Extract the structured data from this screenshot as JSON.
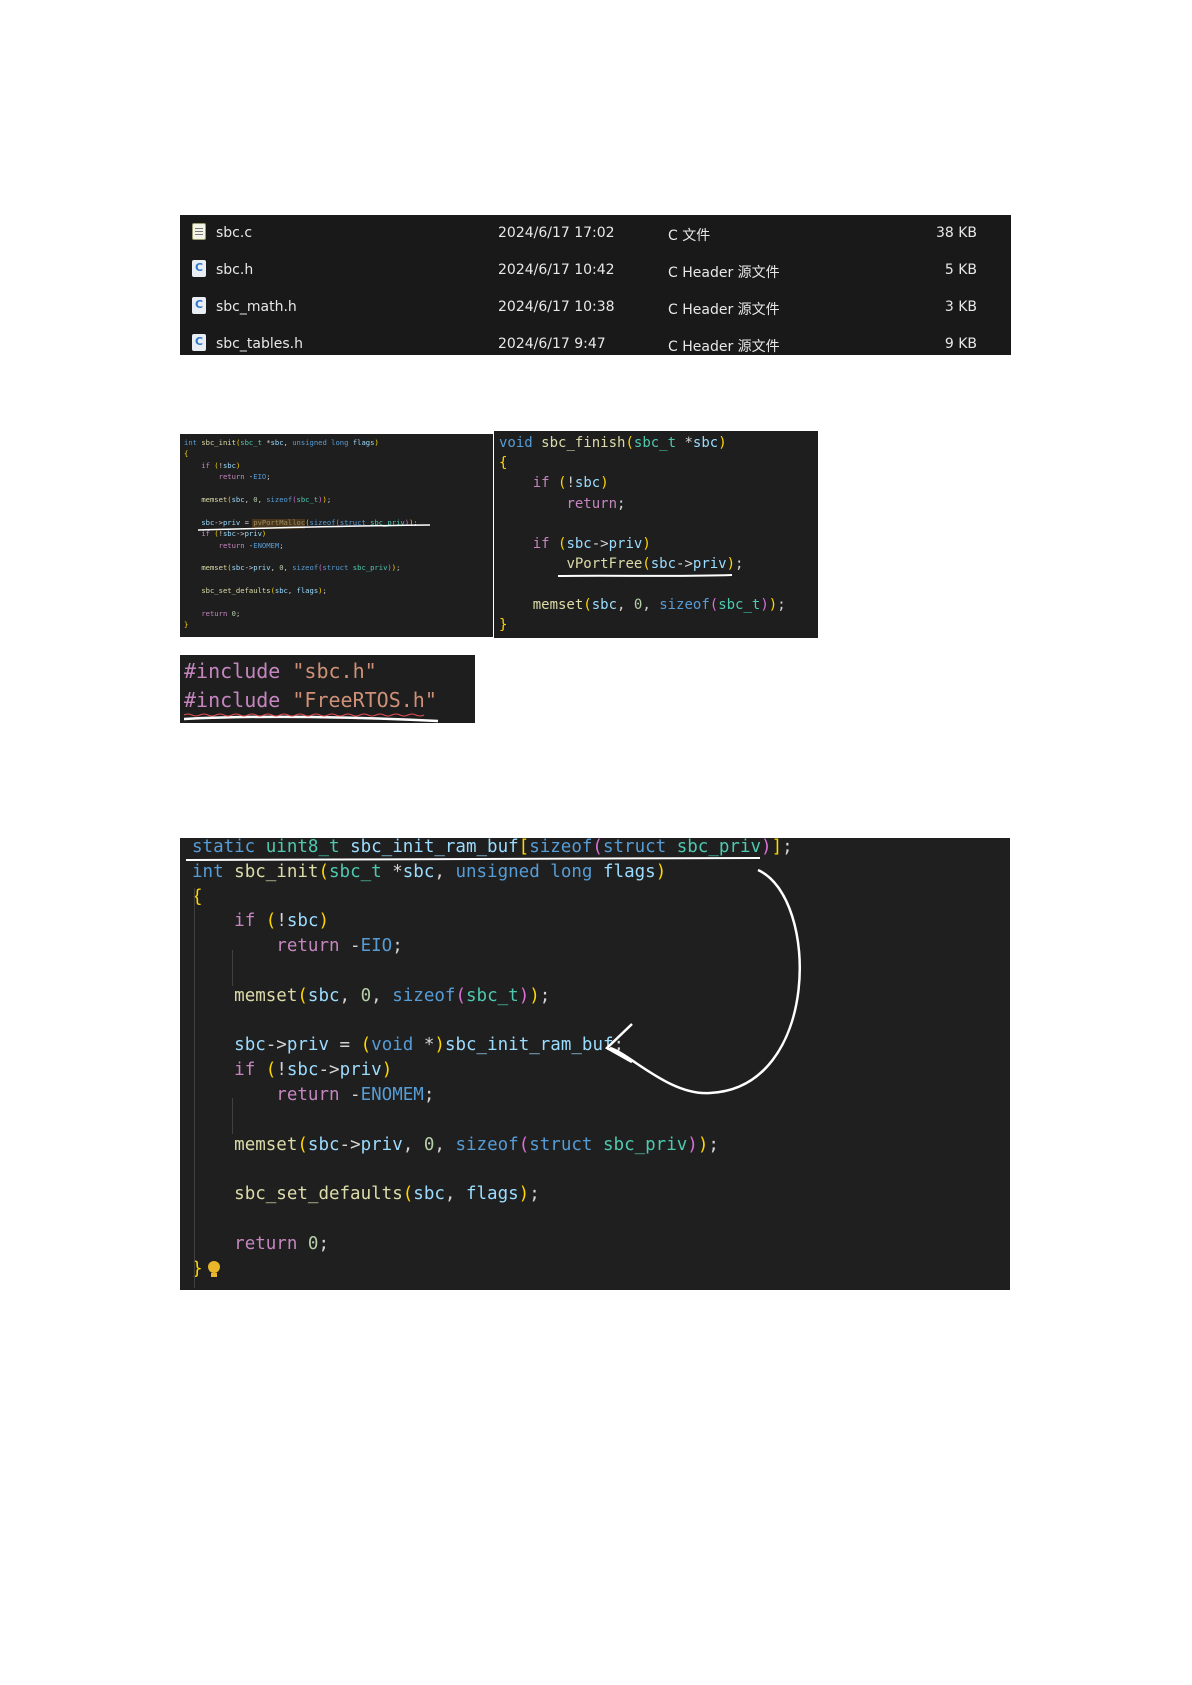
{
  "files": {
    "rows": [
      {
        "name": "sbc.c",
        "date": "2024/6/17 17:02",
        "type": "C 文件",
        "size": "38 KB",
        "icon": "c-source-file-icon"
      },
      {
        "name": "sbc.h",
        "date": "2024/6/17 10:42",
        "type": "C Header 源文件",
        "size": "5 KB",
        "icon": "c-header-file-icon"
      },
      {
        "name": "sbc_math.h",
        "date": "2024/6/17 10:38",
        "type": "C Header 源文件",
        "size": "3 KB",
        "icon": "c-header-file-icon"
      },
      {
        "name": "sbc_tables.h",
        "date": "2024/6/17 9:47",
        "type": "C Header 源文件",
        "size": "9 KB",
        "icon": "c-header-file-icon"
      }
    ]
  },
  "code_small_init": {
    "lines": [
      "int sbc_init(sbc_t *sbc, unsigned long flags)",
      "{",
      "    if (!sbc)",
      "        return -EIO;",
      "",
      "    memset(sbc, 0, sizeof(sbc_t));",
      "",
      "    sbc->priv = pvPortMalloc(sizeof(struct sbc_priv));",
      "    if (!sbc->priv)",
      "        return -ENOMEM;",
      "",
      "    memset(sbc->priv, 0, sizeof(struct sbc_priv));",
      "",
      "    sbc_set_defaults(sbc, flags);",
      "",
      "    return 0;",
      "}"
    ]
  },
  "code_finish": {
    "lines": [
      "void sbc_finish(sbc_t *sbc)",
      "{",
      "    if (!sbc)",
      "        return;",
      "",
      "    if (sbc->priv)",
      "        vPortFree(sbc->priv);",
      "",
      "    memset(sbc, 0, sizeof(sbc_t));",
      "}"
    ]
  },
  "code_includes": {
    "lines": [
      "#include \"sbc.h\"",
      "#include \"FreeRTOS.h\""
    ]
  },
  "code_big_init": {
    "lines": [
      "static uint8_t sbc_init_ram_buf[sizeof(struct sbc_priv)];",
      "int sbc_init(sbc_t *sbc, unsigned long flags)",
      "{",
      "    if (!sbc)",
      "        return -EIO;",
      "",
      "    memset(sbc, 0, sizeof(sbc_t));",
      "",
      "    sbc->priv = (void *)sbc_init_ram_buf;",
      "    if (!sbc->priv)",
      "        return -ENOMEM;",
      "",
      "    memset(sbc->priv, 0, sizeof(struct sbc_priv));",
      "",
      "    sbc_set_defaults(sbc, flags);",
      "",
      "    return 0;",
      "}"
    ]
  },
  "colors": {
    "panel_bg": "#1f1f1f",
    "keyword": "#569cd6",
    "control": "#c586c0",
    "function": "#dcdcaa",
    "type": "#4ec9b0",
    "identifier": "#9cdcfe",
    "string": "#ce9178",
    "annotation": "#ffffff"
  }
}
